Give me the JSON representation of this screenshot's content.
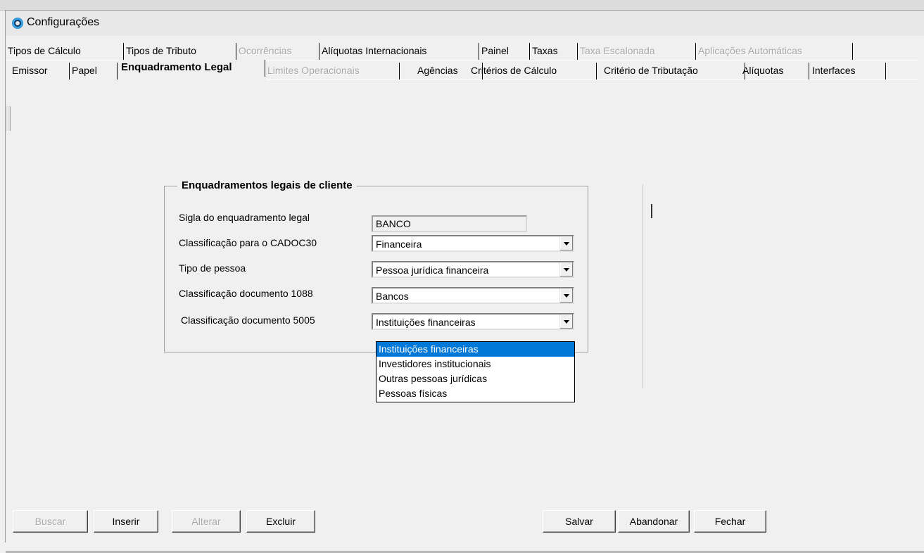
{
  "window": {
    "title": "Configurações"
  },
  "tabs_row1": [
    {
      "label": "Tipos de Cálculo",
      "disabled": false
    },
    {
      "label": "Tipos de Tributo",
      "disabled": false
    },
    {
      "label": "Ocorrências",
      "disabled": true
    },
    {
      "label": "Alíquotas Internacionais",
      "disabled": false
    },
    {
      "label": "Painel",
      "disabled": false
    },
    {
      "label": "Taxas",
      "disabled": false
    },
    {
      "label": "Taxa Escalonada",
      "disabled": true
    },
    {
      "label": "Aplicações Automáticas",
      "disabled": true
    }
  ],
  "tabs_row2": [
    {
      "label": "Emissor",
      "disabled": false
    },
    {
      "label": "Papel",
      "disabled": false
    },
    {
      "label": "Enquadramento Legal",
      "disabled": false,
      "active": true
    },
    {
      "label": "Limites Operacionais",
      "disabled": true
    },
    {
      "label": "Agências",
      "disabled": false
    },
    {
      "label": "Critérios de Cálculo",
      "disabled": false
    },
    {
      "label": "Critério de Tributação",
      "disabled": false
    },
    {
      "label": "Alíquotas",
      "disabled": false
    },
    {
      "label": "Interfaces",
      "disabled": false
    }
  ],
  "group": {
    "title": "Enquadramentos legais de cliente",
    "fields": {
      "sigla": {
        "label": "Sigla do enquadramento legal",
        "value": "BANCO"
      },
      "cadoc30": {
        "label": "Classificação para o CADOC30",
        "value": "Financeira"
      },
      "tipo_pessoa": {
        "label": "Tipo de pessoa",
        "value": "Pessoa jurídica financeira"
      },
      "doc1088": {
        "label": "Classificação  documento 1088",
        "value": "Bancos"
      },
      "doc5005": {
        "label": "Classificação  documento 5005",
        "value": "Instituições financeiras"
      }
    },
    "dropdown_options": [
      "Instituições financeiras",
      "Investidores institucionais",
      "Outras pessoas jurídicas",
      "Pessoas físicas"
    ]
  },
  "buttons": {
    "buscar": {
      "label": "Buscar",
      "disabled": true
    },
    "inserir": {
      "label": "Inserir",
      "disabled": false
    },
    "alterar": {
      "label": "Alterar",
      "disabled": true
    },
    "excluir": {
      "label": "Excluir",
      "disabled": false
    },
    "salvar": {
      "label": "Salvar",
      "disabled": false
    },
    "abandonar": {
      "label": "Abandonar",
      "disabled": false
    },
    "fechar": {
      "label": "Fechar",
      "disabled": false
    }
  },
  "colors": {
    "selection": "#0078d7",
    "disabled_text": "#a8a8a8"
  }
}
